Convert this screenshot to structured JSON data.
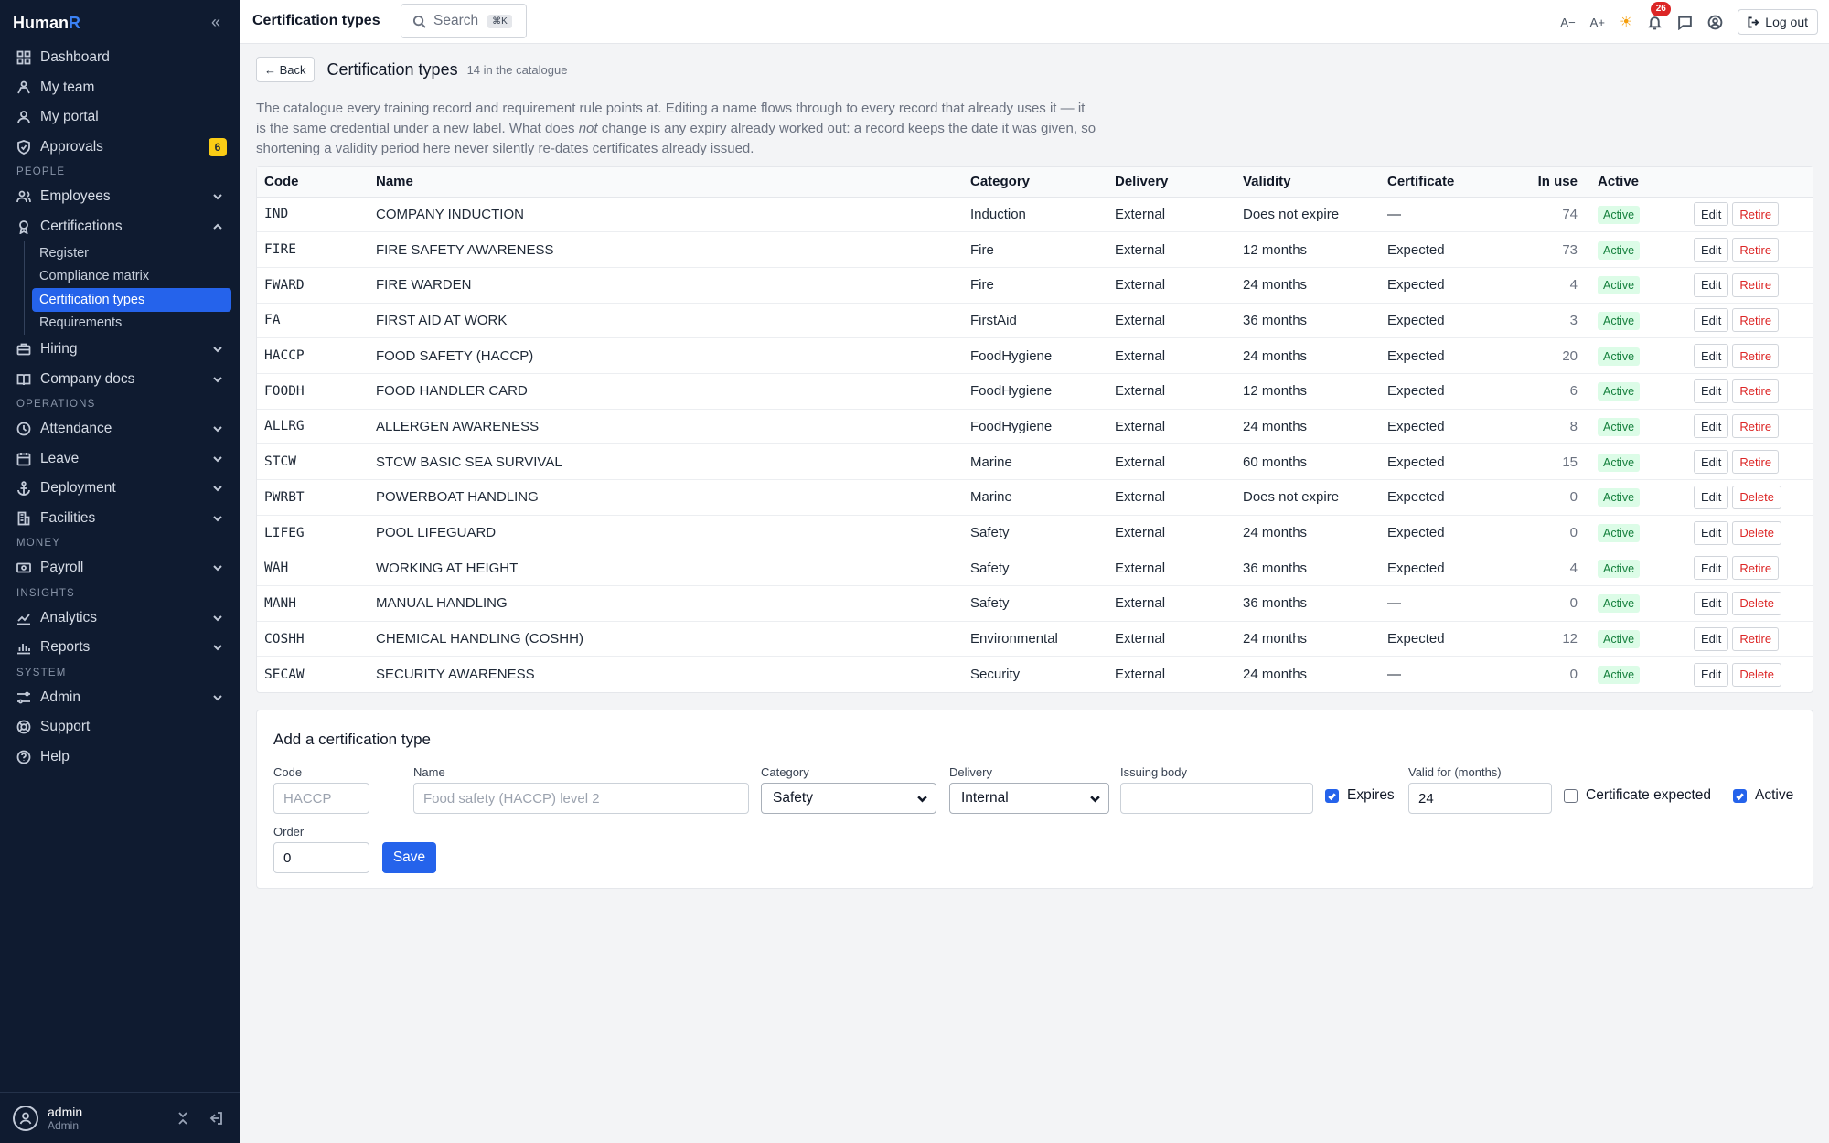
{
  "app": {
    "brand_main": "Human",
    "brand_accent": "R"
  },
  "sidebar": {
    "items_top": [
      {
        "label": "Dashboard",
        "icon": "dashboard-icon"
      },
      {
        "label": "My team",
        "icon": "team-icon"
      },
      {
        "label": "My portal",
        "icon": "user-icon"
      },
      {
        "label": "Approvals",
        "icon": "shield-check-icon",
        "badge": "6"
      }
    ],
    "section_people": "PEOPLE",
    "employees": "Employees",
    "certifications": "Certifications",
    "cert_sub": [
      "Register",
      "Compliance matrix",
      "Certification types",
      "Requirements"
    ],
    "hiring": "Hiring",
    "company_docs": "Company docs",
    "section_operations": "OPERATIONS",
    "attendance": "Attendance",
    "leave": "Leave",
    "deployment": "Deployment",
    "facilities": "Facilities",
    "section_money": "MONEY",
    "payroll": "Payroll",
    "section_insights": "INSIGHTS",
    "analytics": "Analytics",
    "reports": "Reports",
    "section_system": "SYSTEM",
    "admin": "Admin",
    "support": "Support",
    "help": "Help",
    "user_name": "admin",
    "user_role": "Admin"
  },
  "topbar": {
    "title": "Certification types",
    "search_placeholder": "Search",
    "search_shortcut": "⌘K",
    "font_decrease": "A−",
    "font_increase": "A+",
    "notifications_count": "26",
    "logout": "Log out"
  },
  "page": {
    "back": "← Back",
    "title": "Certification types",
    "subtitle": "14 in the catalogue",
    "description_a": "The catalogue every training record and requirement rule points at. Editing a name flows through to every record that already uses it — it is the same credential under a new label. What does ",
    "description_em": "not",
    "description_b": " change is any expiry already worked out: a record keeps the date it was given, so shortening a validity period here never silently re-dates certificates already issued."
  },
  "table": {
    "headers": [
      "Code",
      "Name",
      "Category",
      "Delivery",
      "Validity",
      "Certificate",
      "In use",
      "Active"
    ],
    "rows": [
      {
        "code": "IND",
        "name": "COMPANY INDUCTION",
        "category": "Induction",
        "delivery": "External",
        "validity": "Does not expire",
        "certificate": "—",
        "in_use": "74",
        "active": "Active",
        "edit": "Edit",
        "action": "Retire"
      },
      {
        "code": "FIRE",
        "name": "FIRE SAFETY AWARENESS",
        "category": "Fire",
        "delivery": "External",
        "validity": "12 months",
        "certificate": "Expected",
        "in_use": "73",
        "active": "Active",
        "edit": "Edit",
        "action": "Retire"
      },
      {
        "code": "FWARD",
        "name": "FIRE WARDEN",
        "category": "Fire",
        "delivery": "External",
        "validity": "24 months",
        "certificate": "Expected",
        "in_use": "4",
        "active": "Active",
        "edit": "Edit",
        "action": "Retire"
      },
      {
        "code": "FA",
        "name": "FIRST AID AT WORK",
        "category": "FirstAid",
        "delivery": "External",
        "validity": "36 months",
        "certificate": "Expected",
        "in_use": "3",
        "active": "Active",
        "edit": "Edit",
        "action": "Retire"
      },
      {
        "code": "HACCP",
        "name": "FOOD SAFETY (HACCP)",
        "category": "FoodHygiene",
        "delivery": "External",
        "validity": "24 months",
        "certificate": "Expected",
        "in_use": "20",
        "active": "Active",
        "edit": "Edit",
        "action": "Retire"
      },
      {
        "code": "FOODH",
        "name": "FOOD HANDLER CARD",
        "category": "FoodHygiene",
        "delivery": "External",
        "validity": "12 months",
        "certificate": "Expected",
        "in_use": "6",
        "active": "Active",
        "edit": "Edit",
        "action": "Retire"
      },
      {
        "code": "ALLRG",
        "name": "ALLERGEN AWARENESS",
        "category": "FoodHygiene",
        "delivery": "External",
        "validity": "24 months",
        "certificate": "Expected",
        "in_use": "8",
        "active": "Active",
        "edit": "Edit",
        "action": "Retire"
      },
      {
        "code": "STCW",
        "name": "STCW BASIC SEA SURVIVAL",
        "category": "Marine",
        "delivery": "External",
        "validity": "60 months",
        "certificate": "Expected",
        "in_use": "15",
        "active": "Active",
        "edit": "Edit",
        "action": "Retire"
      },
      {
        "code": "PWRBT",
        "name": "POWERBOAT HANDLING",
        "category": "Marine",
        "delivery": "External",
        "validity": "Does not expire",
        "certificate": "Expected",
        "in_use": "0",
        "active": "Active",
        "edit": "Edit",
        "action": "Delete"
      },
      {
        "code": "LIFEG",
        "name": "POOL LIFEGUARD",
        "category": "Safety",
        "delivery": "External",
        "validity": "24 months",
        "certificate": "Expected",
        "in_use": "0",
        "active": "Active",
        "edit": "Edit",
        "action": "Delete"
      },
      {
        "code": "WAH",
        "name": "WORKING AT HEIGHT",
        "category": "Safety",
        "delivery": "External",
        "validity": "36 months",
        "certificate": "Expected",
        "in_use": "4",
        "active": "Active",
        "edit": "Edit",
        "action": "Retire"
      },
      {
        "code": "MANH",
        "name": "MANUAL HANDLING",
        "category": "Safety",
        "delivery": "External",
        "validity": "36 months",
        "certificate": "—",
        "in_use": "0",
        "active": "Active",
        "edit": "Edit",
        "action": "Delete"
      },
      {
        "code": "COSHH",
        "name": "CHEMICAL HANDLING (COSHH)",
        "category": "Environmental",
        "delivery": "External",
        "validity": "24 months",
        "certificate": "Expected",
        "in_use": "12",
        "active": "Active",
        "edit": "Edit",
        "action": "Retire"
      },
      {
        "code": "SECAW",
        "name": "SECURITY AWARENESS",
        "category": "Security",
        "delivery": "External",
        "validity": "24 months",
        "certificate": "—",
        "in_use": "0",
        "active": "Active",
        "edit": "Edit",
        "action": "Delete"
      }
    ]
  },
  "form": {
    "title": "Add a certification type",
    "code_label": "Code",
    "code_placeholder": "HACCP",
    "name_label": "Name",
    "name_placeholder": "Food safety (HACCP) level 2",
    "category_label": "Category",
    "category_value": "Safety",
    "delivery_label": "Delivery",
    "delivery_value": "Internal",
    "issuing_label": "Issuing body",
    "expires_label": "Expires",
    "expires_checked": true,
    "valid_label": "Valid for (months)",
    "valid_value": "24",
    "cert_expected_label": "Certificate expected",
    "cert_expected_checked": false,
    "active_label": "Active",
    "active_checked": true,
    "order_label": "Order",
    "order_value": "0",
    "save": "Save"
  },
  "colors": {
    "sidebar_bg": "#0f1b30",
    "accent": "#2563eb",
    "danger": "#dc2626",
    "active_pill": "#dcfce7",
    "badge": "#facc15"
  }
}
